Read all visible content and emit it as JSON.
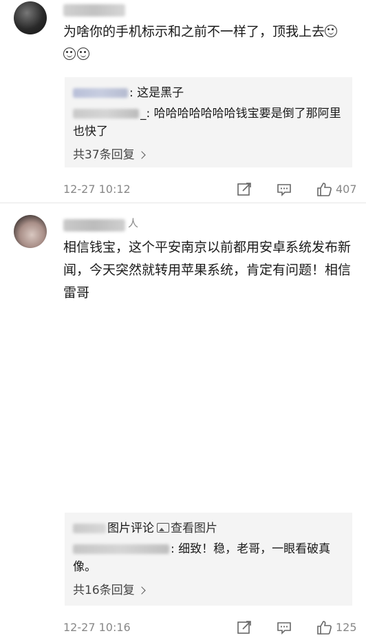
{
  "comments": [
    {
      "text": "为啥你的手机标示和之前不一样了，顶我上去",
      "emojis": [
        "grin-emoji",
        "grin-emoji",
        "grin-emoji"
      ],
      "replies": [
        {
          "text": "这是黑子"
        },
        {
          "text": "哈哈哈哈哈哈哈钱宝要是倒了那阿里也快了"
        }
      ],
      "reply_total": "共37条回复",
      "time": "12-27 10:12",
      "likes": "407"
    },
    {
      "name_suffix": "人",
      "text": "相信钱宝，这个平安南京以前都用安卓系统发布新闻，今天突然就转用苹果系统，肯定有问题！相信雷哥",
      "replies": [
        {
          "label": "图片评论",
          "link": "查看图片"
        },
        {
          "text": "细致！稳，老哥，一眼看破真像。"
        }
      ],
      "reply_total": "共16条回复",
      "time": "12-27 10:16",
      "likes": "125"
    }
  ],
  "icons": {
    "share": "share-edit-icon",
    "reply": "comment-bubble-icon",
    "like": "thumbs-up-icon",
    "picture": "picture-icon",
    "more": "chevron-right-icon"
  },
  "colors": {
    "meta_gray": "#888888",
    "reply_bg": "#f4f4f4",
    "text": "#1a1a1a"
  }
}
